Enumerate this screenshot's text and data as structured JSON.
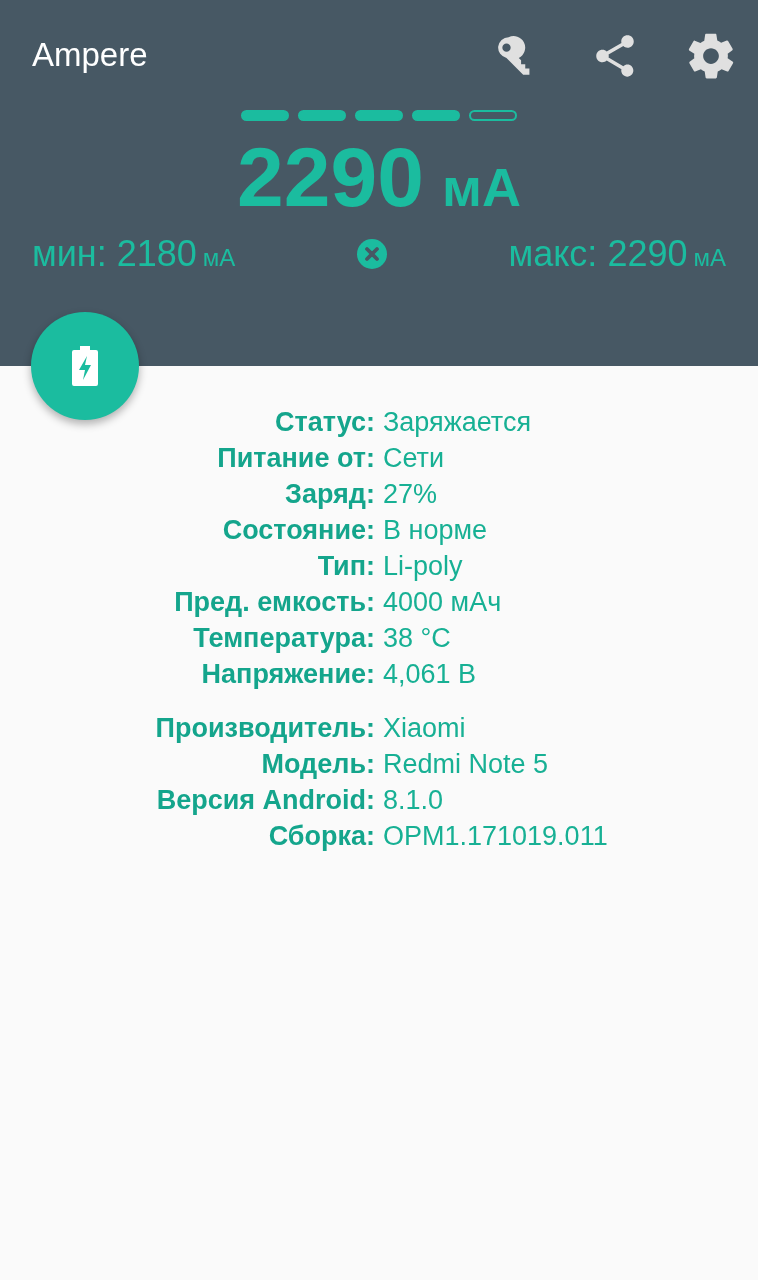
{
  "app_bar": {
    "title": "Ampere"
  },
  "meter": {
    "segments": [
      {
        "on": true
      },
      {
        "on": true
      },
      {
        "on": true
      },
      {
        "on": true
      },
      {
        "on": false
      }
    ],
    "value": "2290",
    "unit": "мА"
  },
  "range": {
    "min_label": "мин:",
    "min_value": "2180",
    "min_unit": "мА",
    "max_label": "макс:",
    "max_value": "2290",
    "max_unit": "мА"
  },
  "info_groups": [
    {
      "rows": [
        {
          "label": "Статус:",
          "value": "Заряжается"
        },
        {
          "label": "Питание от:",
          "value": "Сети"
        },
        {
          "label": "Заряд:",
          "value": "27%"
        },
        {
          "label": "Состояние:",
          "value": "В норме"
        },
        {
          "label": "Тип:",
          "value": "Li-poly"
        },
        {
          "label": "Пред. емкость:",
          "value": "4000 мАч"
        },
        {
          "label": "Температура:",
          "value": "38 °C"
        },
        {
          "label": "Напряжение:",
          "value": "4,061 В"
        }
      ]
    },
    {
      "rows": [
        {
          "label": "Производитель:",
          "value": "Xiaomi"
        },
        {
          "label": "Модель:",
          "value": "Redmi Note 5"
        },
        {
          "label": "Версия Android:",
          "value": "8.1.0"
        },
        {
          "label": "Сборка:",
          "value": "OPM1.171019.011"
        }
      ]
    }
  ]
}
